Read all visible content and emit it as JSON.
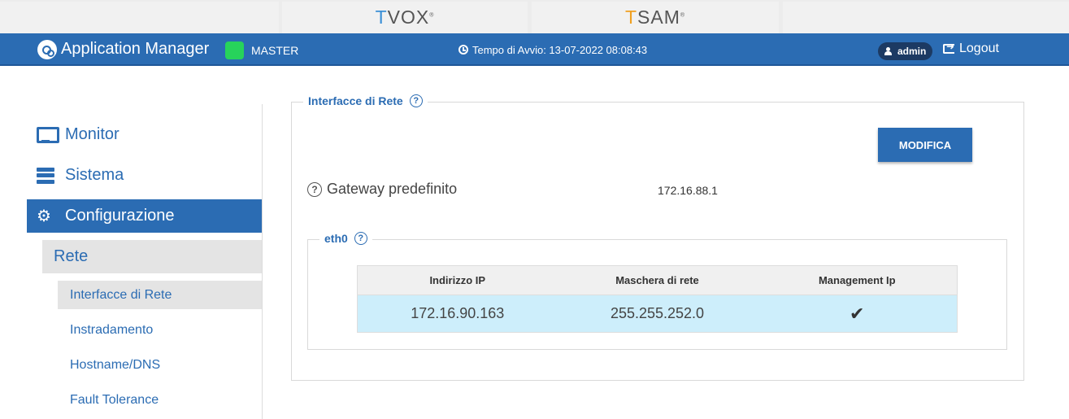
{
  "products": {
    "tvox": {
      "first": "T",
      "rest": "V",
      "mid": "OX",
      "reg": "®"
    },
    "tsam": {
      "first": "T",
      "rest": "SAM",
      "reg": "®"
    }
  },
  "header": {
    "app_title": "Application Manager",
    "node_role": "MASTER",
    "start_time": "Tempo di Avvio: 13-07-2022 08:08:43",
    "user": "admin",
    "logout": "Logout",
    "status_color": "#27d35b",
    "brand_color": "#2b6cb3"
  },
  "sidebar": {
    "items": [
      {
        "label": "Monitor",
        "icon": "monitor-icon"
      },
      {
        "label": "Sistema",
        "icon": "server-icon"
      },
      {
        "label": "Configurazione",
        "icon": "gears-icon",
        "active": true
      }
    ],
    "sub": {
      "label": "Rete"
    },
    "subsub": [
      {
        "label": "Interfacce di Rete",
        "active": true
      },
      {
        "label": "Instradamento"
      },
      {
        "label": "Hostname/DNS"
      },
      {
        "label": "Fault Tolerance"
      }
    ]
  },
  "main": {
    "section_title": "Interfacce di Rete",
    "edit_button": "MODIFICA",
    "gateway_label": "Gateway predefinito",
    "gateway_value": "172.16.88.1",
    "interface": {
      "name": "eth0",
      "columns": [
        "Indirizzo IP",
        "Maschera di rete",
        "Management Ip"
      ],
      "rows": [
        {
          "ip": "172.16.90.163",
          "mask": "255.255.252.0",
          "management": "✔"
        }
      ]
    },
    "help_glyph": "?"
  }
}
